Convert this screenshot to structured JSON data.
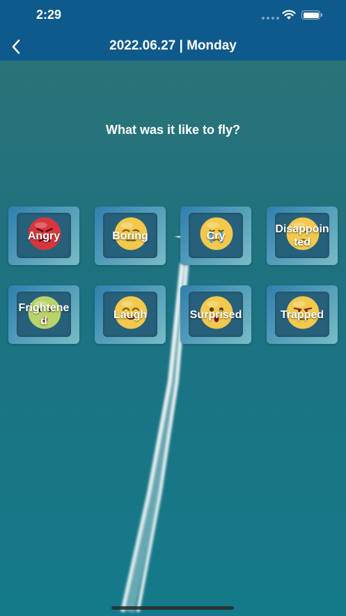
{
  "status_bar": {
    "time": "2:29"
  },
  "nav": {
    "title": "2022.06.27 | Monday",
    "back_icon": "chevron-left-icon"
  },
  "question": "What was it like to fly?",
  "moods": [
    {
      "label": "Angry",
      "icon": "angry-face-icon",
      "color": "#d8363e"
    },
    {
      "label": "Boring",
      "icon": "bored-face-icon",
      "color": "#f2c94c"
    },
    {
      "label": "Cry",
      "icon": "crying-face-icon",
      "color": "#f2c94c"
    },
    {
      "label": "Disappointed",
      "icon": "disappointed-face-icon",
      "color": "#f2c94c"
    },
    {
      "label": "Frightened",
      "icon": "frightened-face-icon",
      "color": "#b9d36b"
    },
    {
      "label": "Laugh",
      "icon": "laughing-face-icon",
      "color": "#f2c94c"
    },
    {
      "label": "Surprised",
      "icon": "surprised-face-icon",
      "color": "#f2c94c"
    },
    {
      "label": "Trapped",
      "icon": "trapped-face-icon",
      "color": "#f2c94c"
    }
  ]
}
